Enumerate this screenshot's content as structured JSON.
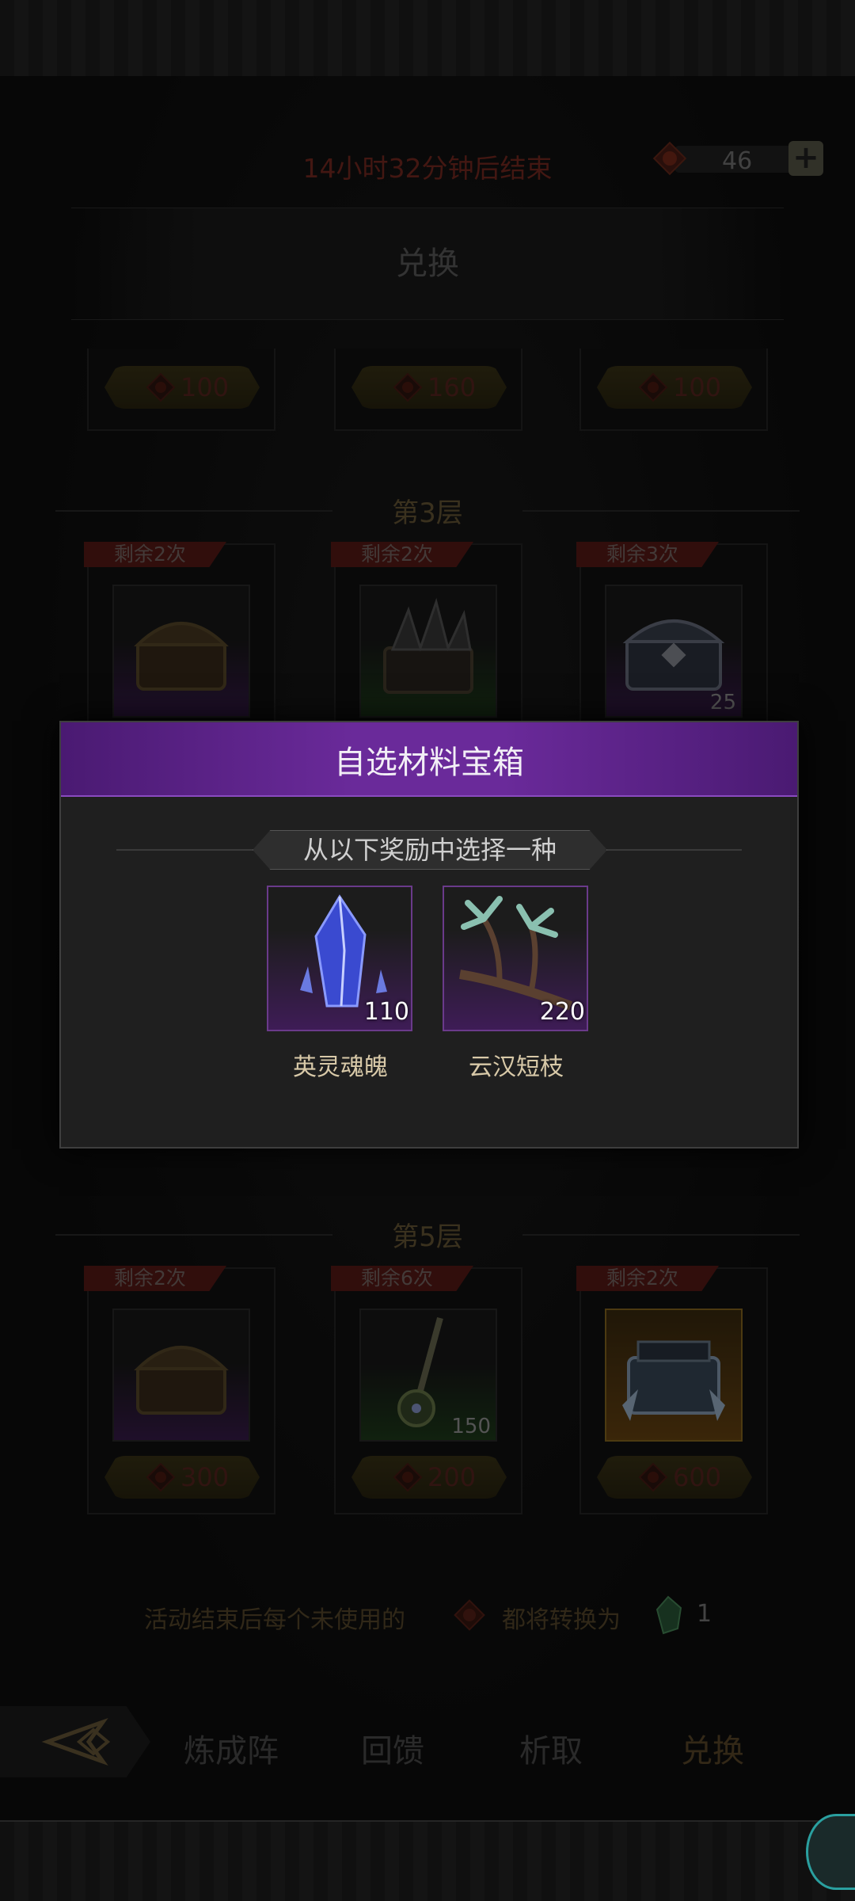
{
  "header": {
    "timer_text": "14小时32分钟后结束",
    "currency_amount": "46",
    "plus_label": "+"
  },
  "banner": {
    "title": "兑换"
  },
  "top_prices": [
    "100",
    "160",
    "100"
  ],
  "tier3": {
    "title": "第3层",
    "cards": [
      {
        "remain": "剩余2次",
        "icon": "wooden-chest-icon",
        "rarity": "purple",
        "count": ""
      },
      {
        "remain": "剩余2次",
        "icon": "thorn-chest-icon",
        "rarity": "green",
        "count": ""
      },
      {
        "remain": "剩余3次",
        "icon": "iron-chest-icon",
        "rarity": "purple",
        "count": "25"
      }
    ]
  },
  "tier5": {
    "title": "第5层",
    "cards": [
      {
        "remain": "剩余2次",
        "icon": "wooden-chest-icon",
        "rarity": "purple",
        "count": "",
        "price": "300"
      },
      {
        "remain": "剩余6次",
        "icon": "scepter-icon",
        "rarity": "green",
        "count": "150",
        "price": "200"
      },
      {
        "remain": "剩余2次",
        "icon": "frost-chest-icon",
        "rarity": "gold",
        "count": "",
        "price": "600"
      }
    ]
  },
  "notice": {
    "text_before": "活动结束后每个未使用的",
    "text_after": "都将转换为",
    "amount": "1"
  },
  "nav": {
    "tabs": [
      "炼成阵",
      "回馈",
      "析取",
      "兑换"
    ],
    "active": "兑换"
  },
  "modal": {
    "title": "自选材料宝箱",
    "subtitle": "从以下奖励中选择一种",
    "rewards": [
      {
        "name": "英灵魂魄",
        "count": "110",
        "icon": "blue-crystal-icon"
      },
      {
        "name": "云汉短枝",
        "count": "220",
        "icon": "branch-icon"
      }
    ]
  },
  "colors": {
    "modal_header": "#6a2a9a",
    "remain_tag": "#5a1a17",
    "currency_coin": "#8a2a1a"
  }
}
